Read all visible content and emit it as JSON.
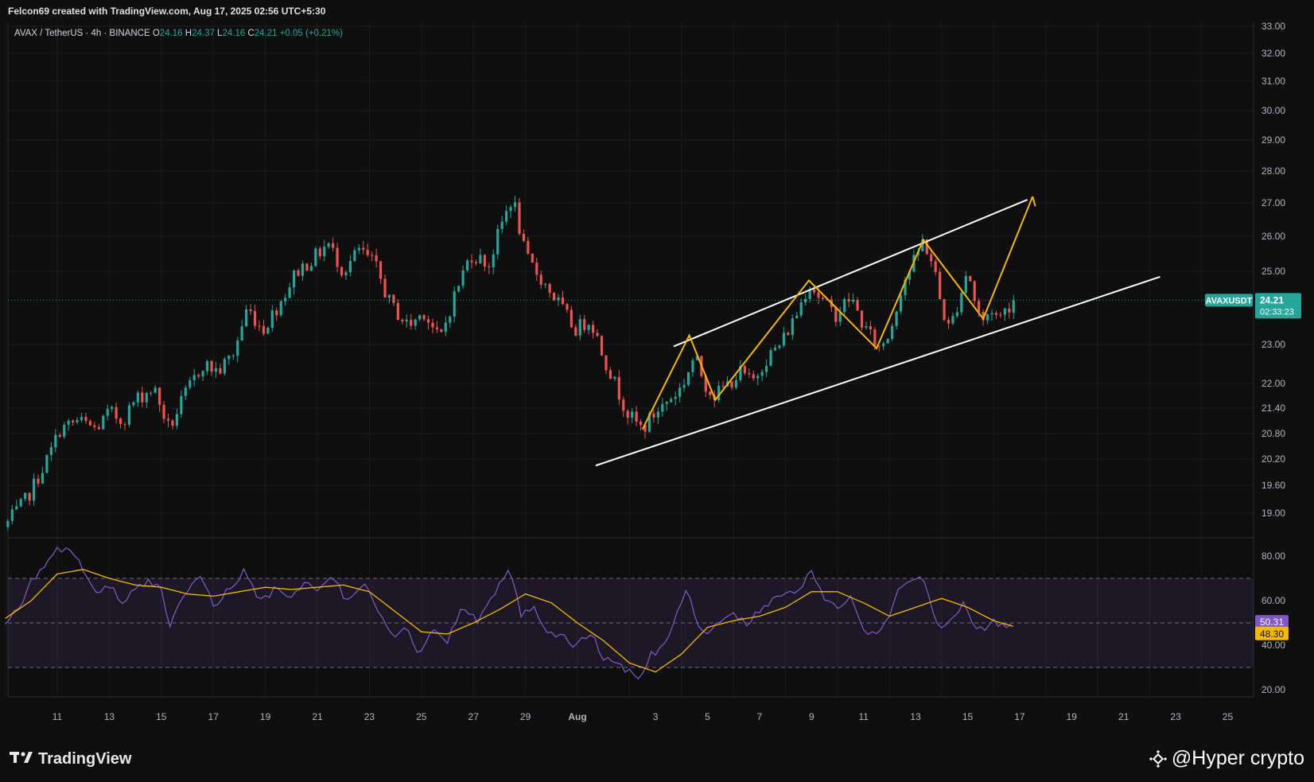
{
  "header": {
    "credit": "Felcon69 created with TradingView.com, Aug 17, 2025 02:56 UTC+5:30"
  },
  "legend": {
    "symbol": "AVAX / TetherUS · 4h · BINANCE",
    "o_label": "O",
    "o_value": "24.16",
    "h_label": "H",
    "h_value": "24.37",
    "l_label": "L",
    "l_value": "24.16",
    "c_label": "C",
    "c_value": "24.21",
    "change": "+0.05 (+0.21%)"
  },
  "price_tag": {
    "ticker": "AVAXUSDT",
    "price": "24.21",
    "countdown": "02:33:23"
  },
  "rsi_tags": {
    "rsi": "50.31",
    "ma": "48.30"
  },
  "footer": {
    "brand": "TradingView",
    "watermark": "@Hyper crypto"
  },
  "colors": {
    "background": "#0f0f0f",
    "up": "#26a69a",
    "down": "#ef5350",
    "pattern": "#f5b800",
    "channel": "#ffffff",
    "rsi": "#7e57c2",
    "rsi_ma": "#f5b800"
  },
  "chart_data": [
    {
      "type": "candlestick",
      "symbol": "AVAXUSDT",
      "interval": "4h",
      "ylim": [
        18.7,
        33.2
      ],
      "price_ticks": [
        "33.00",
        "32.00",
        "31.00",
        "30.00",
        "29.00",
        "28.00",
        "27.00",
        "26.00",
        "25.00",
        "23.00",
        "22.00",
        "21.40",
        "20.80",
        "20.20",
        "19.60",
        "19.00"
      ],
      "x_labels": [
        "11",
        "13",
        "15",
        "17",
        "19",
        "21",
        "23",
        "25",
        "27",
        "29",
        "Aug",
        "3",
        "5",
        "7",
        "9",
        "11",
        "13",
        "15",
        "17",
        "19",
        "21",
        "23",
        "25"
      ],
      "close_anchors": [
        {
          "day": 9.1,
          "close": 18.8
        },
        {
          "day": 9.7,
          "close": 19.2
        },
        {
          "day": 10.1,
          "close": 19.6
        },
        {
          "day": 10.7,
          "close": 20.3
        },
        {
          "day": 11.1,
          "close": 20.9
        },
        {
          "day": 11.8,
          "close": 21.1
        },
        {
          "day": 12.5,
          "close": 20.9
        },
        {
          "day": 13.0,
          "close": 21.3
        },
        {
          "day": 13.5,
          "close": 21.1
        },
        {
          "day": 14.0,
          "close": 21.6
        },
        {
          "day": 14.7,
          "close": 21.9
        },
        {
          "day": 15.3,
          "close": 20.9
        },
        {
          "day": 15.9,
          "close": 21.7
        },
        {
          "day": 16.6,
          "close": 22.5
        },
        {
          "day": 17.2,
          "close": 22.3
        },
        {
          "day": 17.8,
          "close": 22.8
        },
        {
          "day": 18.3,
          "close": 24.0
        },
        {
          "day": 18.9,
          "close": 23.4
        },
        {
          "day": 19.6,
          "close": 24.2
        },
        {
          "day": 20.2,
          "close": 25.0
        },
        {
          "day": 20.9,
          "close": 25.4
        },
        {
          "day": 21.4,
          "close": 25.8
        },
        {
          "day": 22.0,
          "close": 25.0
        },
        {
          "day": 22.6,
          "close": 25.6
        },
        {
          "day": 23.2,
          "close": 25.2
        },
        {
          "day": 23.8,
          "close": 24.1
        },
        {
          "day": 24.5,
          "close": 23.5
        },
        {
          "day": 25.1,
          "close": 23.9
        },
        {
          "day": 25.7,
          "close": 23.1
        },
        {
          "day": 26.3,
          "close": 24.4
        },
        {
          "day": 26.9,
          "close": 25.5
        },
        {
          "day": 27.6,
          "close": 25.2
        },
        {
          "day": 28.1,
          "close": 26.4
        },
        {
          "day": 28.5,
          "close": 27.2
        },
        {
          "day": 29.0,
          "close": 25.4
        },
        {
          "day": 29.6,
          "close": 24.8
        },
        {
          "day": 30.3,
          "close": 24.1
        },
        {
          "day": 30.9,
          "close": 23.4
        },
        {
          "day": 31.5,
          "close": 23.7
        },
        {
          "day": 32.0,
          "close": 22.7
        },
        {
          "day": 32.5,
          "close": 21.9
        },
        {
          "day": 33.0,
          "close": 21.2
        },
        {
          "day": 33.5,
          "close": 20.9
        },
        {
          "day": 34.0,
          "close": 21.3
        },
        {
          "day": 34.5,
          "close": 21.6
        },
        {
          "day": 35.0,
          "close": 21.9
        },
        {
          "day": 35.5,
          "close": 22.7
        },
        {
          "day": 35.9,
          "close": 22.0
        },
        {
          "day": 36.3,
          "close": 21.7
        },
        {
          "day": 36.8,
          "close": 22.0
        },
        {
          "day": 37.3,
          "close": 22.3
        },
        {
          "day": 37.7,
          "close": 22.0
        },
        {
          "day": 38.2,
          "close": 22.6
        },
        {
          "day": 38.8,
          "close": 23.0
        },
        {
          "day": 39.4,
          "close": 23.8
        },
        {
          "day": 39.9,
          "close": 24.7
        },
        {
          "day": 40.4,
          "close": 24.2
        },
        {
          "day": 40.9,
          "close": 23.8
        },
        {
          "day": 41.5,
          "close": 24.3
        },
        {
          "day": 42.0,
          "close": 23.5
        },
        {
          "day": 42.6,
          "close": 22.9
        },
        {
          "day": 43.0,
          "close": 23.3
        },
        {
          "day": 43.5,
          "close": 24.7
        },
        {
          "day": 43.9,
          "close": 25.2
        },
        {
          "day": 44.3,
          "close": 25.9
        },
        {
          "day": 44.7,
          "close": 25.1
        },
        {
          "day": 45.0,
          "close": 24.0
        },
        {
          "day": 45.3,
          "close": 23.4
        },
        {
          "day": 45.7,
          "close": 24.3
        },
        {
          "day": 46.0,
          "close": 25.1
        },
        {
          "day": 46.3,
          "close": 24.1
        },
        {
          "day": 46.6,
          "close": 23.6
        },
        {
          "day": 46.9,
          "close": 24.0
        },
        {
          "day": 47.2,
          "close": 23.7
        },
        {
          "day": 47.5,
          "close": 24.0
        },
        {
          "day": 47.8,
          "close": 24.21
        }
      ],
      "channel_upper": [
        {
          "day": 34.7,
          "price": 22.95
        },
        {
          "day": 44.4,
          "price": 26.05
        },
        {
          "day": 48.3,
          "price": 27.1
        }
      ],
      "channel_lower": [
        {
          "day": 31.7,
          "price": 20.05
        },
        {
          "day": 53.4,
          "price": 24.85
        }
      ],
      "pattern_path": [
        {
          "day": 33.5,
          "price": 20.9
        },
        {
          "day": 35.3,
          "price": 23.25
        },
        {
          "day": 36.3,
          "price": 21.6
        },
        {
          "day": 39.9,
          "price": 24.75
        },
        {
          "day": 42.5,
          "price": 22.9
        },
        {
          "day": 44.3,
          "price": 25.9
        },
        {
          "day": 46.6,
          "price": 23.7
        },
        {
          "day": 48.5,
          "price": 27.2
        }
      ],
      "projection_tip": {
        "day": 48.6,
        "price": 26.9
      }
    },
    {
      "type": "line",
      "name": "RSI",
      "ylim": [
        15,
        90
      ],
      "y_ticks": [
        "80.00",
        "60.00",
        "40.00",
        "20.00"
      ],
      "band": [
        30,
        70
      ],
      "midline": 50,
      "rsi_anchors": [
        {
          "day": 9.0,
          "v": 51
        },
        {
          "day": 9.5,
          "v": 56
        },
        {
          "day": 10.0,
          "v": 69
        },
        {
          "day": 10.4,
          "v": 74
        },
        {
          "day": 11.1,
          "v": 84
        },
        {
          "day": 11.6,
          "v": 80
        },
        {
          "day": 12.0,
          "v": 74
        },
        {
          "day": 12.5,
          "v": 62
        },
        {
          "day": 13.0,
          "v": 67
        },
        {
          "day": 13.5,
          "v": 58
        },
        {
          "day": 14.0,
          "v": 65
        },
        {
          "day": 14.5,
          "v": 68
        },
        {
          "day": 15.0,
          "v": 66
        },
        {
          "day": 15.3,
          "v": 48
        },
        {
          "day": 15.8,
          "v": 60
        },
        {
          "day": 16.5,
          "v": 71
        },
        {
          "day": 17.0,
          "v": 58
        },
        {
          "day": 17.6,
          "v": 65
        },
        {
          "day": 18.2,
          "v": 73
        },
        {
          "day": 18.8,
          "v": 60
        },
        {
          "day": 19.4,
          "v": 65
        },
        {
          "day": 20.0,
          "v": 62
        },
        {
          "day": 20.6,
          "v": 70
        },
        {
          "day": 21.0,
          "v": 64
        },
        {
          "day": 21.5,
          "v": 72
        },
        {
          "day": 22.2,
          "v": 59
        },
        {
          "day": 22.8,
          "v": 68
        },
        {
          "day": 23.3,
          "v": 55
        },
        {
          "day": 23.9,
          "v": 44
        },
        {
          "day": 24.4,
          "v": 48
        },
        {
          "day": 24.9,
          "v": 37
        },
        {
          "day": 25.4,
          "v": 46
        },
        {
          "day": 26.0,
          "v": 42
        },
        {
          "day": 26.6,
          "v": 58
        },
        {
          "day": 27.2,
          "v": 50
        },
        {
          "day": 27.9,
          "v": 66
        },
        {
          "day": 28.4,
          "v": 76
        },
        {
          "day": 28.8,
          "v": 54
        },
        {
          "day": 29.3,
          "v": 58
        },
        {
          "day": 29.8,
          "v": 47
        },
        {
          "day": 30.4,
          "v": 44
        },
        {
          "day": 30.9,
          "v": 40
        },
        {
          "day": 31.5,
          "v": 45
        },
        {
          "day": 32.0,
          "v": 35
        },
        {
          "day": 32.5,
          "v": 32
        },
        {
          "day": 33.0,
          "v": 28
        },
        {
          "day": 33.3,
          "v": 23
        },
        {
          "day": 33.8,
          "v": 36
        },
        {
          "day": 34.2,
          "v": 38
        },
        {
          "day": 34.6,
          "v": 45
        },
        {
          "day": 35.0,
          "v": 60
        },
        {
          "day": 35.2,
          "v": 66
        },
        {
          "day": 35.5,
          "v": 52
        },
        {
          "day": 36.0,
          "v": 45
        },
        {
          "day": 36.5,
          "v": 51
        },
        {
          "day": 37.0,
          "v": 55
        },
        {
          "day": 37.5,
          "v": 49
        },
        {
          "day": 38.0,
          "v": 56
        },
        {
          "day": 38.5,
          "v": 60
        },
        {
          "day": 39.0,
          "v": 63
        },
        {
          "day": 39.5,
          "v": 66
        },
        {
          "day": 40.0,
          "v": 72
        },
        {
          "day": 40.5,
          "v": 62
        },
        {
          "day": 41.0,
          "v": 57
        },
        {
          "day": 41.5,
          "v": 63
        },
        {
          "day": 42.0,
          "v": 48
        },
        {
          "day": 42.4,
          "v": 44
        },
        {
          "day": 42.9,
          "v": 50
        },
        {
          "day": 43.3,
          "v": 65
        },
        {
          "day": 43.8,
          "v": 68
        },
        {
          "day": 44.3,
          "v": 71
        },
        {
          "day": 44.6,
          "v": 58
        },
        {
          "day": 45.0,
          "v": 46
        },
        {
          "day": 45.4,
          "v": 52
        },
        {
          "day": 45.8,
          "v": 59
        },
        {
          "day": 46.2,
          "v": 50
        },
        {
          "day": 46.6,
          "v": 47
        },
        {
          "day": 47.0,
          "v": 51
        },
        {
          "day": 47.4,
          "v": 48
        },
        {
          "day": 47.8,
          "v": 50.31
        }
      ],
      "ma_anchors": [
        {
          "day": 9.0,
          "v": 52
        },
        {
          "day": 10.0,
          "v": 60
        },
        {
          "day": 11.0,
          "v": 72
        },
        {
          "day": 12.0,
          "v": 74
        },
        {
          "day": 13.0,
          "v": 70
        },
        {
          "day": 14.0,
          "v": 67
        },
        {
          "day": 15.0,
          "v": 66
        },
        {
          "day": 16.0,
          "v": 63
        },
        {
          "day": 17.0,
          "v": 62
        },
        {
          "day": 18.0,
          "v": 64
        },
        {
          "day": 19.0,
          "v": 66
        },
        {
          "day": 20.0,
          "v": 65
        },
        {
          "day": 21.0,
          "v": 66
        },
        {
          "day": 22.0,
          "v": 67
        },
        {
          "day": 23.0,
          "v": 64
        },
        {
          "day": 24.0,
          "v": 55
        },
        {
          "day": 25.0,
          "v": 46
        },
        {
          "day": 26.0,
          "v": 45
        },
        {
          "day": 27.0,
          "v": 50
        },
        {
          "day": 28.0,
          "v": 56
        },
        {
          "day": 29.0,
          "v": 63
        },
        {
          "day": 30.0,
          "v": 59
        },
        {
          "day": 31.0,
          "v": 50
        },
        {
          "day": 32.0,
          "v": 42
        },
        {
          "day": 33.0,
          "v": 32
        },
        {
          "day": 34.0,
          "v": 28
        },
        {
          "day": 35.0,
          "v": 36
        },
        {
          "day": 36.0,
          "v": 48
        },
        {
          "day": 37.0,
          "v": 51
        },
        {
          "day": 38.0,
          "v": 53
        },
        {
          "day": 39.0,
          "v": 57
        },
        {
          "day": 40.0,
          "v": 64
        },
        {
          "day": 41.0,
          "v": 64
        },
        {
          "day": 42.0,
          "v": 59
        },
        {
          "day": 43.0,
          "v": 53
        },
        {
          "day": 44.0,
          "v": 57
        },
        {
          "day": 45.0,
          "v": 61
        },
        {
          "day": 46.0,
          "v": 57
        },
        {
          "day": 47.0,
          "v": 51
        },
        {
          "day": 47.8,
          "v": 48.3
        }
      ]
    }
  ]
}
